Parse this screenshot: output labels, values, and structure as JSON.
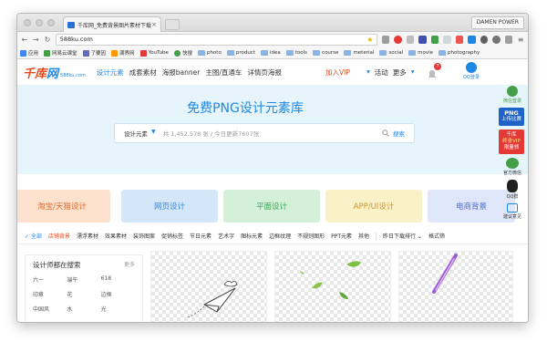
{
  "browser": {
    "tab_title": "千库网_免费背景图片素材下载",
    "tab_close": "×",
    "profile": "DAMEN POWER",
    "url": "588ku.com",
    "bookmarks": [
      "应用",
      "网易云课堂",
      "了要因",
      "满界网",
      "YouTube",
      "快搜",
      "photo",
      "product",
      "idea",
      "tools",
      "course",
      "meterial",
      "social",
      "movie",
      "photography"
    ]
  },
  "site": {
    "logo_main": "千库",
    "logo_accent": "网",
    "logo_sub": "588ku.com",
    "nav": [
      "设计元素",
      "成套素材",
      "海报banner",
      "主图/直通车",
      "详情页海报"
    ],
    "vip": "加入VIP",
    "right_links": [
      "活动",
      "更多"
    ],
    "notification_count": "7",
    "login_qq": "QQ登录",
    "login_wechat": "微信登录"
  },
  "hero": {
    "title": "免费PNG设计元素库",
    "search_category": "设计元素",
    "search_placeholder": "共 1,452,578 张 / 今日更新7607张",
    "search_button": "搜索"
  },
  "categories": [
    {
      "label": "淘宝/天猫设计",
      "bg": "#fde1cf",
      "fg": "#e06a2b"
    },
    {
      "label": "网页设计",
      "bg": "#d4e7f8",
      "fg": "#3b86d8"
    },
    {
      "label": "平面设计",
      "bg": "#d5f0d9",
      "fg": "#3ca35a"
    },
    {
      "label": "APP/UI设计",
      "bg": "#fbf1c8",
      "fg": "#c9962a"
    },
    {
      "label": "电商背景",
      "bg": "#e0e6f9",
      "fg": "#4a6ad1"
    }
  ],
  "filters": {
    "all": "全部",
    "items": [
      "店铺背景",
      "漂浮素材",
      "效果素材",
      "装饰图案",
      "促销标签",
      "节日元素",
      "艺术字",
      "图标元素",
      "边框纹理",
      "不规则图形",
      "PPT元素",
      "其他"
    ],
    "sort": "昨日下载排行",
    "format": "格式筛"
  },
  "sidebox": {
    "title": "设计师都在搜索",
    "more": "更多",
    "tags": [
      "六一",
      "端午",
      "618",
      "印章",
      "花",
      "边框",
      "中国风",
      "水",
      "光"
    ]
  },
  "floating": {
    "png_badge": "PNG",
    "png_sub": "上传比赛",
    "vip_top": "千库",
    "vip_mid": "终身VIP",
    "vip_sub": "限量领",
    "wechat": "官方微信",
    "qq": "QQ群",
    "feedback": "建议意见"
  },
  "colors": {
    "brand_blue": "#1e88e5",
    "brand_orange": "#e64a19",
    "hero_bg": "#e6f4fc"
  }
}
